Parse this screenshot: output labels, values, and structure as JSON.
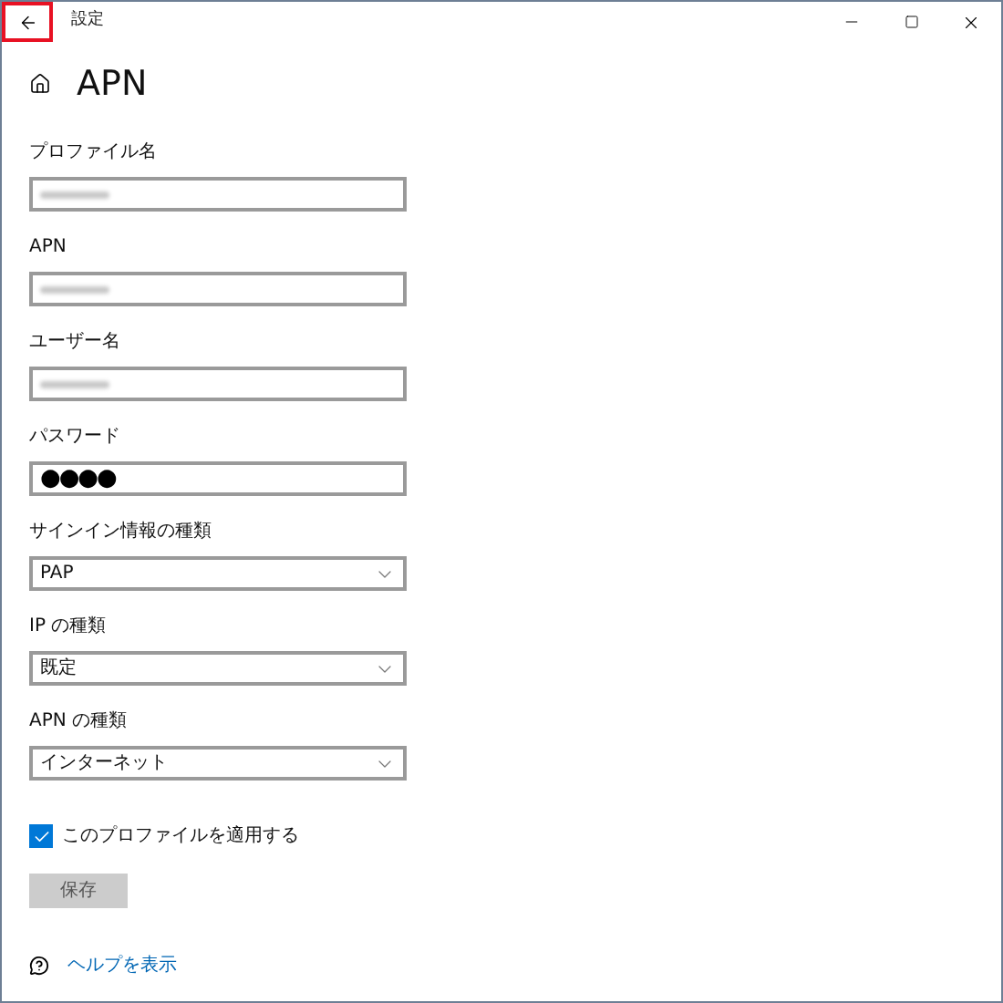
{
  "window": {
    "title": "設定",
    "back_highlighted": true
  },
  "page": {
    "title": "APN"
  },
  "fields": [
    {
      "kind": "text",
      "label": "プロファイル名",
      "redacted": true
    },
    {
      "kind": "text",
      "label": "APN",
      "redacted": true
    },
    {
      "kind": "text",
      "label": "ユーザー名",
      "redacted": true
    },
    {
      "kind": "text",
      "label": "パスワード",
      "value": "●●●●"
    },
    {
      "kind": "select",
      "label": "サインイン情報の種類",
      "value": "PAP"
    },
    {
      "kind": "select",
      "label": "IP の種類",
      "value": "既定"
    },
    {
      "kind": "select",
      "label": "APN の種類",
      "value": "インターネット"
    }
  ],
  "apply_checkbox": {
    "label": "このプロファイルを適用する",
    "checked": true
  },
  "save_button": "保存",
  "help_link": "ヘルプを表示"
}
